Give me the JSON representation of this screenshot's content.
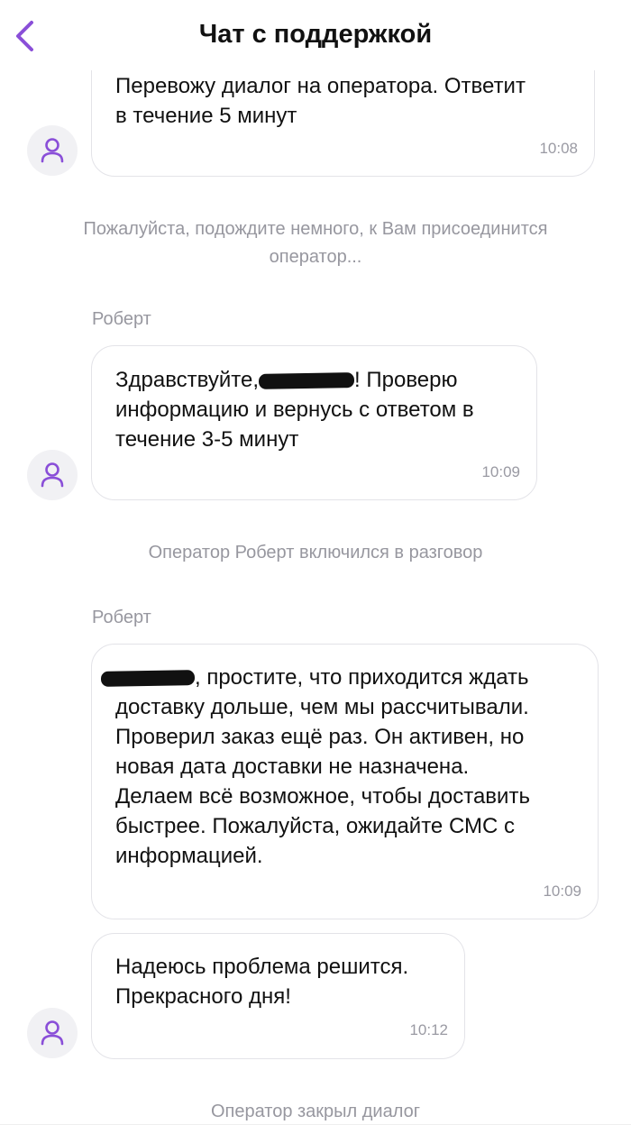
{
  "header": {
    "title": "Чат с поддержкой",
    "back_icon": "chevron-left-icon",
    "accent": "#8a4fd8"
  },
  "messages": [
    {
      "text_lines": "Перевожу диалог на оператора. Ответит\nв течение 5 минут",
      "time": "10:08"
    },
    {
      "text_pre": "Здравствуйте,",
      "text_post": "! Проверю\nинформацию и вернусь с ответом в\nтечение 3-5 минут",
      "time": "10:09"
    },
    {
      "text_post": ", простите, что приходится ждать\nдоставку дольше, чем мы рассчитывали.\nПроверил заказ ещё раз. Он активен, но\nновая дата доставки не назначена.\nДелаем всё возможное, чтобы доставить\nбыстрее. Пожалуйста, ожидайте СМС с\nинформацией.",
      "time": "10:09"
    },
    {
      "text_lines": "Надеюсь проблема решится.\nПрекрасного дня!",
      "time": "10:12"
    }
  ],
  "system": {
    "wait": "Пожалуйста, подождите немного, к Вам присоединится\nоператор...",
    "joined": "Оператор Роберт включился в разговор",
    "closed": "Оператор закрыл диалог"
  },
  "authors": {
    "robert": "Роберт"
  },
  "icons": {
    "avatar": "user-icon"
  }
}
